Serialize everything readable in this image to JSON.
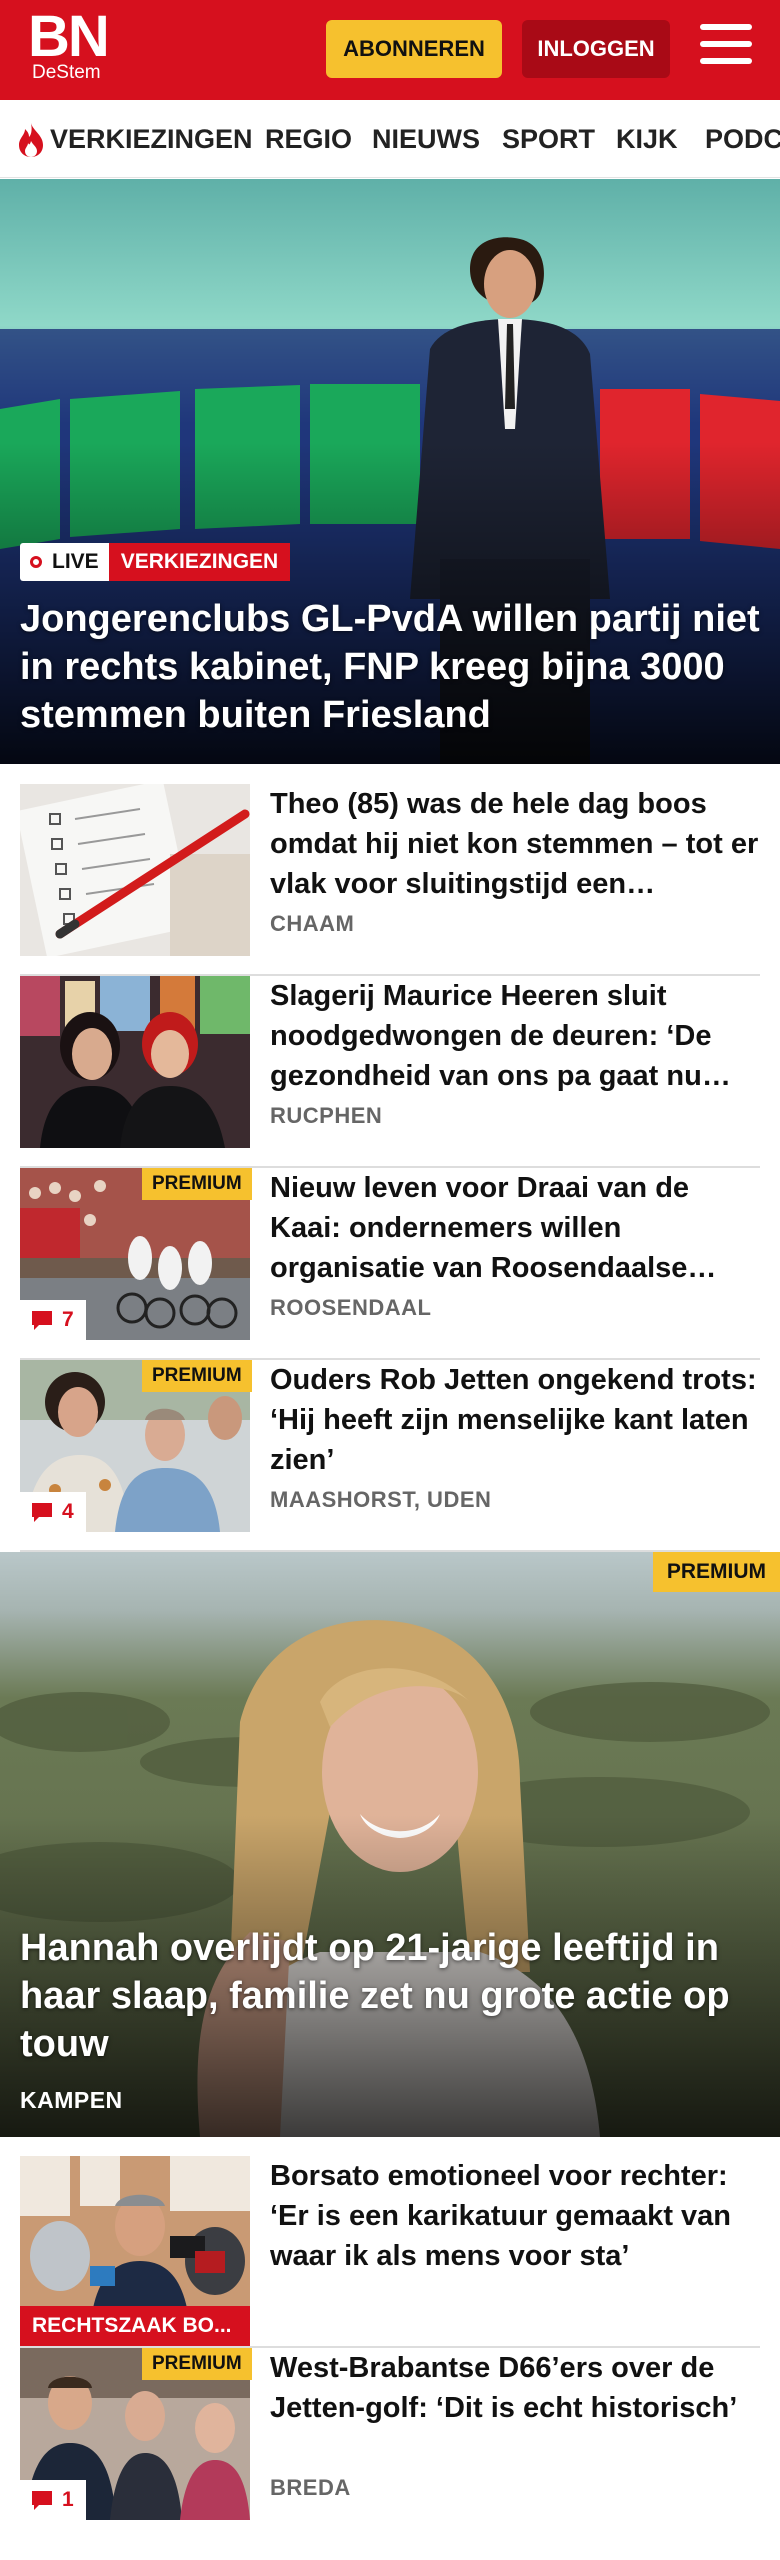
{
  "header": {
    "logo_top": "BN",
    "logo_bottom": "DeStem",
    "subscribe_label": "ABONNEREN",
    "login_label": "INLOGGEN",
    "menu_icon": "hamburger-menu-icon"
  },
  "nav": {
    "items": [
      {
        "label": "VERKIEZINGEN",
        "icon": "flame-icon"
      },
      {
        "label": "REGIO"
      },
      {
        "label": "NIEUWS"
      },
      {
        "label": "SPORT"
      },
      {
        "label": "KIJK"
      },
      {
        "label": "PODCAST"
      }
    ]
  },
  "hero": {
    "live_label": "LIVE",
    "section_label": "VERKIEZINGEN",
    "title": "Jongerenclubs GL-PvdA willen partij niet in rechts kabinet, FNP kreeg bijna 3000 stemmen buiten Friesland"
  },
  "articles": [
    {
      "title": "Theo (85) was de hele dag boos omdat hij niet kon stemmen – tot er vlak voor sluitingstijd een…",
      "location": "CHAAM"
    },
    {
      "title": "Slagerij Maurice Heeren sluit noodgedwongen de deuren: ‘De gezondheid van ons pa gaat nu…",
      "location": "RUCPHEN"
    },
    {
      "title": "Nieuw leven voor Draai van de Kaai: ondernemers willen organisatie van Roosendaalse…",
      "location": "ROOSENDAAL",
      "premium": "PREMIUM",
      "comments": "7"
    },
    {
      "title": "Ouders Rob Jetten ongekend trots: ‘Hij heeft zijn menselijke kant laten zien’",
      "location": "MAASHORST, UDEN",
      "premium": "PREMIUM",
      "comments": "4"
    }
  ],
  "feature": {
    "premium": "PREMIUM",
    "title": "Hannah overlijdt op 21-jarige leeftijd in haar slaap, familie zet nu grote actie op touw",
    "location": "KAMPEN"
  },
  "articles2": [
    {
      "title": "Borsato emotioneel voor rechter: ‘Er is een karikatuur gemaakt van waar ik als mens voor sta’",
      "tag": "RECHTSZAAK BO..."
    },
    {
      "title": "West-Brabantse D66’ers over de Jetten-golf: ‘Dit is echt historisch’",
      "location": "BREDA",
      "premium": "PREMIUM",
      "comments": "1"
    }
  ],
  "colors": {
    "brand_red": "#d6101e",
    "premium_yellow": "#f6c12e",
    "login_dark_red": "#a90a16"
  }
}
